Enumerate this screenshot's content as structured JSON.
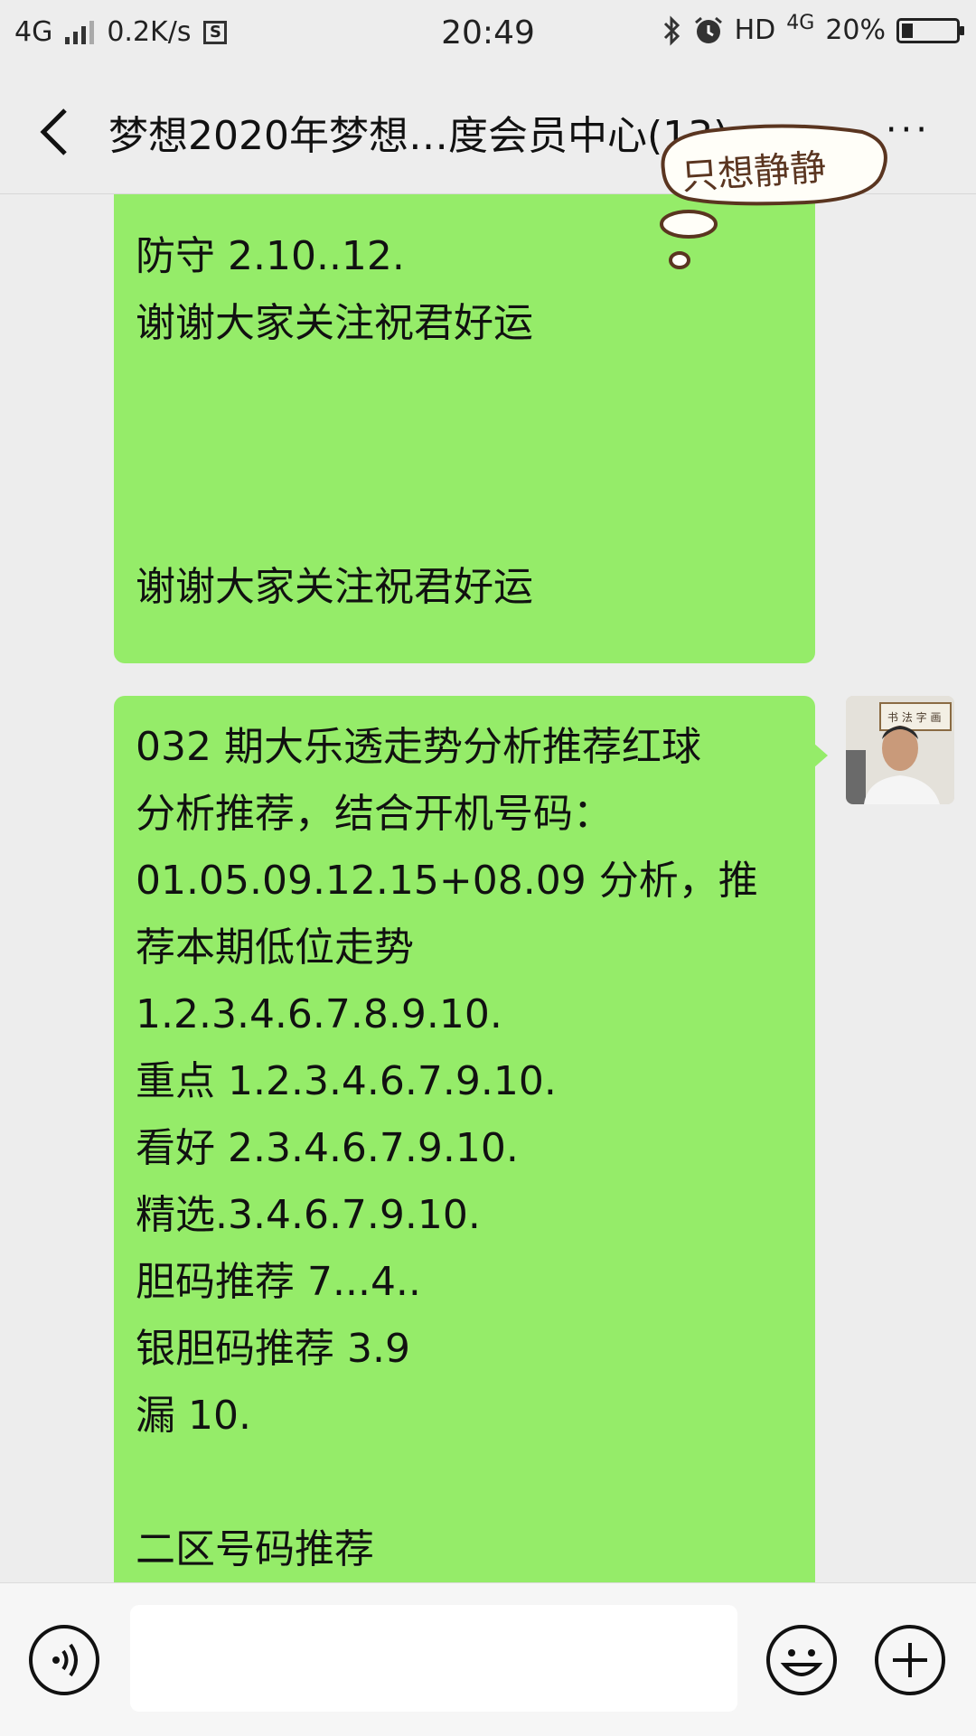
{
  "status_bar": {
    "network": "4G",
    "speed": "0.2K/s",
    "sim_badge": "S",
    "time": "20:49",
    "hd": "HD",
    "network_right": "4G",
    "battery": "20%",
    "battery_level": 0.2
  },
  "header": {
    "title": "梦想2020年梦想…度会员中心(13)",
    "more_label": "···"
  },
  "sticker": {
    "text": "只想静静"
  },
  "messages": [
    {
      "lines": [
        "防守 2.10..12.",
        "谢谢大家关注祝君好运",
        "谢谢大家关注祝君好运"
      ]
    },
    {
      "lines": [
        "032 期大乐透走势分析推荐红球",
        "分析推荐，结合开机号码：",
        "01.05.09.12.15+08.09 分析，推",
        "荐本期低位走势",
        "1.2.3.4.6.7.8.9.10.",
        "重点 1.2.3.4.6.7.9.10.",
        "看好 2.3.4.6.7.9.10.",
        "精选.3.4.6.7.9.10.",
        "胆码推荐 7...4..",
        "银胆码推荐 3.9",
        "漏 10.",
        "",
        "二区号码推荐"
      ]
    }
  ],
  "input": {
    "value": "",
    "placeholder": ""
  },
  "colors": {
    "bubble": "#95ec69",
    "background": "#ededed"
  },
  "icons": {
    "back": "back-arrow-icon",
    "voice": "voice-icon",
    "emoji": "emoji-icon",
    "plus": "plus-icon"
  }
}
